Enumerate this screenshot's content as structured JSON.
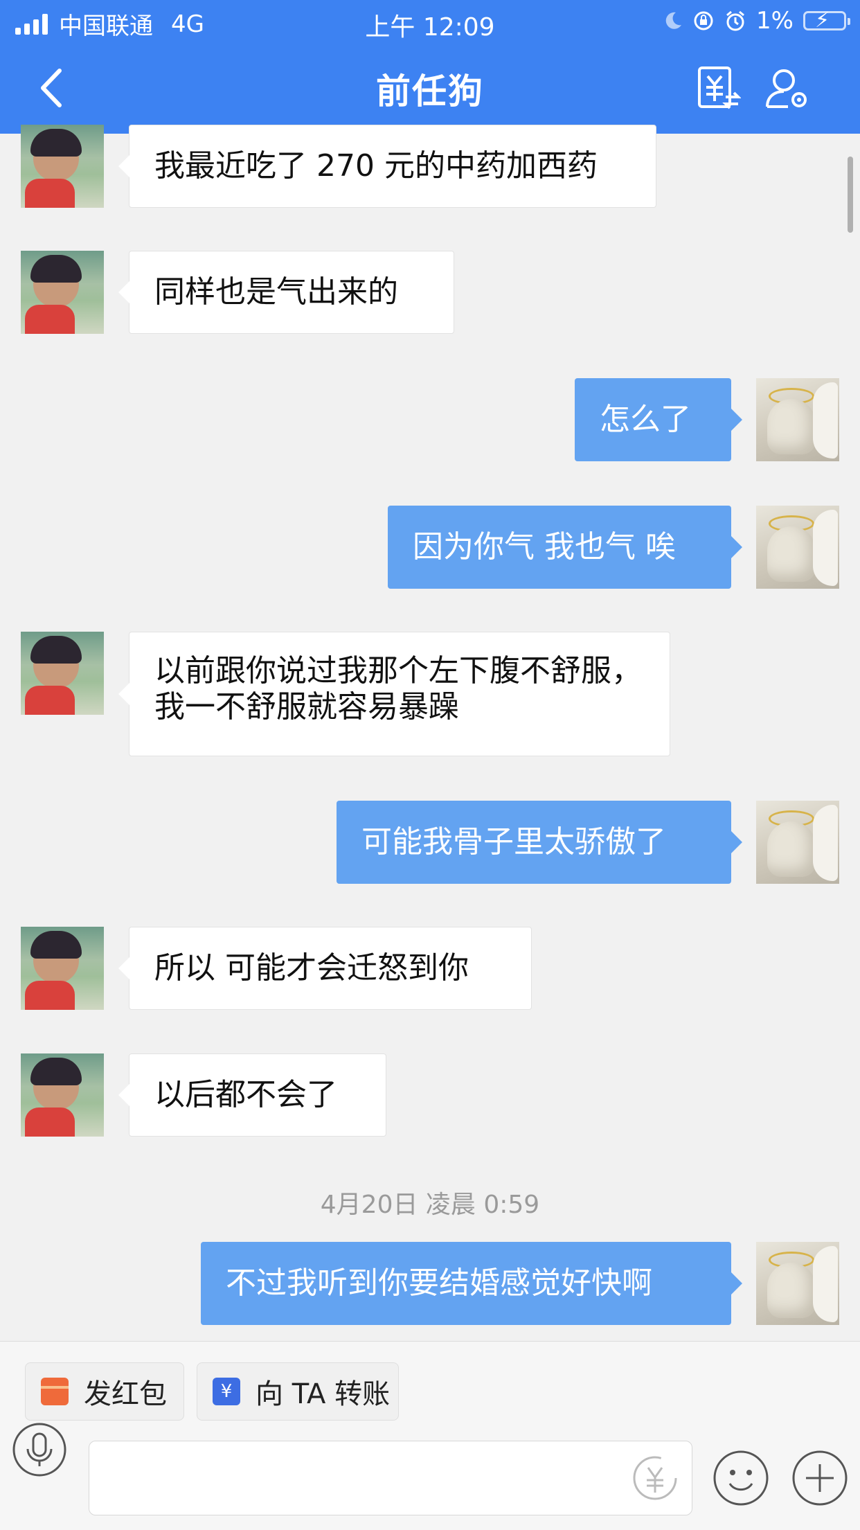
{
  "status_bar": {
    "carrier": "中国联通",
    "network": "4G",
    "time": "上午 12:09",
    "battery": "1%"
  },
  "nav": {
    "title": "前任狗"
  },
  "messages": [
    {
      "side": "in",
      "text": "我最近吃了 270 元的中药加西药"
    },
    {
      "side": "in",
      "text": "同样也是气出来的"
    },
    {
      "side": "out",
      "text": "怎么了"
    },
    {
      "side": "out",
      "text": "因为你气 我也气 唉"
    },
    {
      "side": "in",
      "text": "以前跟你说过我那个左下腹不舒服，我一不舒服就容易暴躁"
    },
    {
      "side": "out",
      "text": "可能我骨子里太骄傲了"
    },
    {
      "side": "in",
      "text": "所以 可能才会迁怒到你"
    },
    {
      "side": "in",
      "text": "以后都不会了"
    },
    {
      "side": "out",
      "text": "不过我听到你要结婚感觉好快啊"
    }
  ],
  "timestamp": "4月20日 凌晨 0:59",
  "quick_actions": {
    "red_packet": "发红包",
    "transfer": "向 TA 转账"
  },
  "colors": {
    "header": "#3d82f2",
    "outgoing_bubble": "#63a3f1",
    "incoming_bubble": "#ffffff",
    "background": "#f1f1f1"
  }
}
